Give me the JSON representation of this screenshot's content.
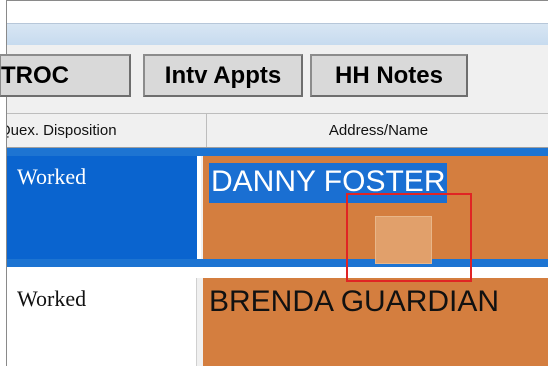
{
  "tabs": [
    {
      "label": "TROC"
    },
    {
      "label": "Intv Appts"
    },
    {
      "label": "HH Notes"
    }
  ],
  "grid": {
    "columns": [
      {
        "label": "Quex. Disposition"
      },
      {
        "label": "Address/Name"
      }
    ],
    "rows": [
      {
        "disposition": "Worked",
        "name": "DANNY FOSTER",
        "selected": true
      },
      {
        "disposition": "Worked",
        "name": "BRENDA GUARDIAN",
        "selected": false
      }
    ]
  },
  "colors": {
    "selection_blue": "#0a64cf",
    "address_cell_orange": "#d47e3f",
    "highlight_box_red": "#e02424"
  }
}
